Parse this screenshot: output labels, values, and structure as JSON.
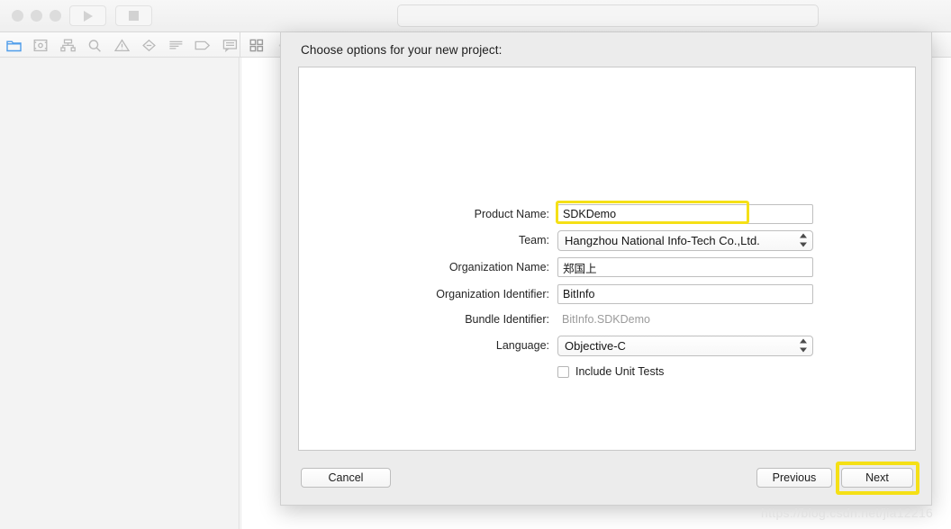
{
  "window": {
    "traffic_lights": [
      "close",
      "minimize",
      "zoom"
    ],
    "run_button_icon": "play-icon",
    "stop_button_icon": "stop-icon",
    "activity_field_value": "",
    "activity_field_placeholder": ""
  },
  "navigator_toolbar": {
    "icons": [
      {
        "name": "project-navigator-icon",
        "active": true
      },
      {
        "name": "source-control-navigator-icon",
        "active": false
      },
      {
        "name": "symbol-navigator-icon",
        "active": false
      },
      {
        "name": "find-navigator-icon",
        "active": false
      },
      {
        "name": "issue-navigator-icon",
        "active": false
      },
      {
        "name": "test-navigator-icon",
        "active": false
      },
      {
        "name": "debug-navigator-icon",
        "active": false
      },
      {
        "name": "breakpoint-navigator-icon",
        "active": false
      },
      {
        "name": "report-navigator-icon",
        "active": false
      }
    ],
    "right_icon": "grid-view-icon",
    "chevron_icon": "chevron-left-icon"
  },
  "dialog": {
    "title": "Choose options for your new project:",
    "fields": [
      {
        "label": "Product Name:",
        "type": "text",
        "value": "SDKDemo",
        "highlighted": true
      },
      {
        "label": "Team:",
        "type": "popup",
        "value": "Hangzhou National Info-Tech Co.,Ltd.",
        "highlighted": false
      },
      {
        "label": "Organization Name:",
        "type": "text",
        "value": "郑国上",
        "highlighted": false
      },
      {
        "label": "Organization Identifier:",
        "type": "text",
        "value": "BitInfo",
        "highlighted": false
      },
      {
        "label": "Bundle Identifier:",
        "type": "static",
        "value": "BitInfo.SDKDemo",
        "highlighted": false
      },
      {
        "label": "Language:",
        "type": "popup",
        "value": "Objective-C",
        "highlighted": false
      }
    ],
    "checkbox": {
      "label": "Include Unit Tests",
      "checked": false
    },
    "buttons": {
      "cancel": "Cancel",
      "previous": "Previous",
      "next": "Next"
    },
    "highlight_color": "#f5e016"
  },
  "watermark": {
    "text": "https://blog.csdn.net/jia12216"
  }
}
